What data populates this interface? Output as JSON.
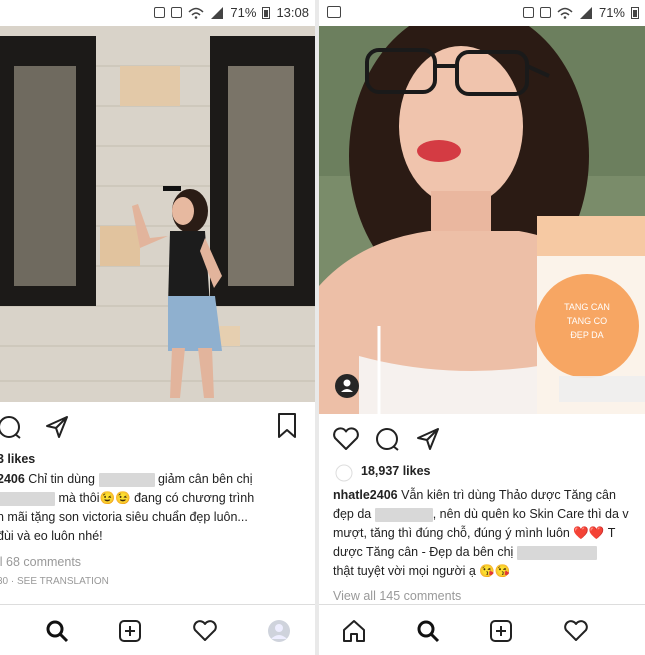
{
  "left": {
    "status": {
      "battery": "71%",
      "time": "13:08"
    },
    "post": {
      "likes": "3 likes",
      "caption_user": "2406",
      "line1_a": "Chỉ tin dùng",
      "line1_b": "giảm cân bên chị",
      "line2_b": "mà thôi😉😉 đang có chương trình",
      "line3": "n mãi tặng son victoria siêu chuẩn đẹp luôn...",
      "line4": "đùi và eo luôn nhé!",
      "view_comments": "ll 68 comments",
      "time": "30",
      "see_translation": "SEE TRANSLATION"
    }
  },
  "right": {
    "status": {
      "battery": "71%"
    },
    "product_text": "TANG CAN\nTANG CO\nĐẸP DA",
    "post": {
      "likes": "18,937 likes",
      "caption_user": "nhatle2406",
      "line1": "Vẫn kiên trì dùng Thảo dược Tăng cân",
      "line2_a": "đẹp da",
      "line2_b": ", nên dù quên ko Skin Care thì da v",
      "line3": "mượt, tăng thì đúng chỗ, đúng ý mình luôn ❤️❤️ T",
      "line4_a": "dược Tăng cân - Đẹp da bên chị",
      "line5": "thật tuyệt vời mọi người ạ 😘😘",
      "view_comments": "View all 145 comments"
    }
  }
}
